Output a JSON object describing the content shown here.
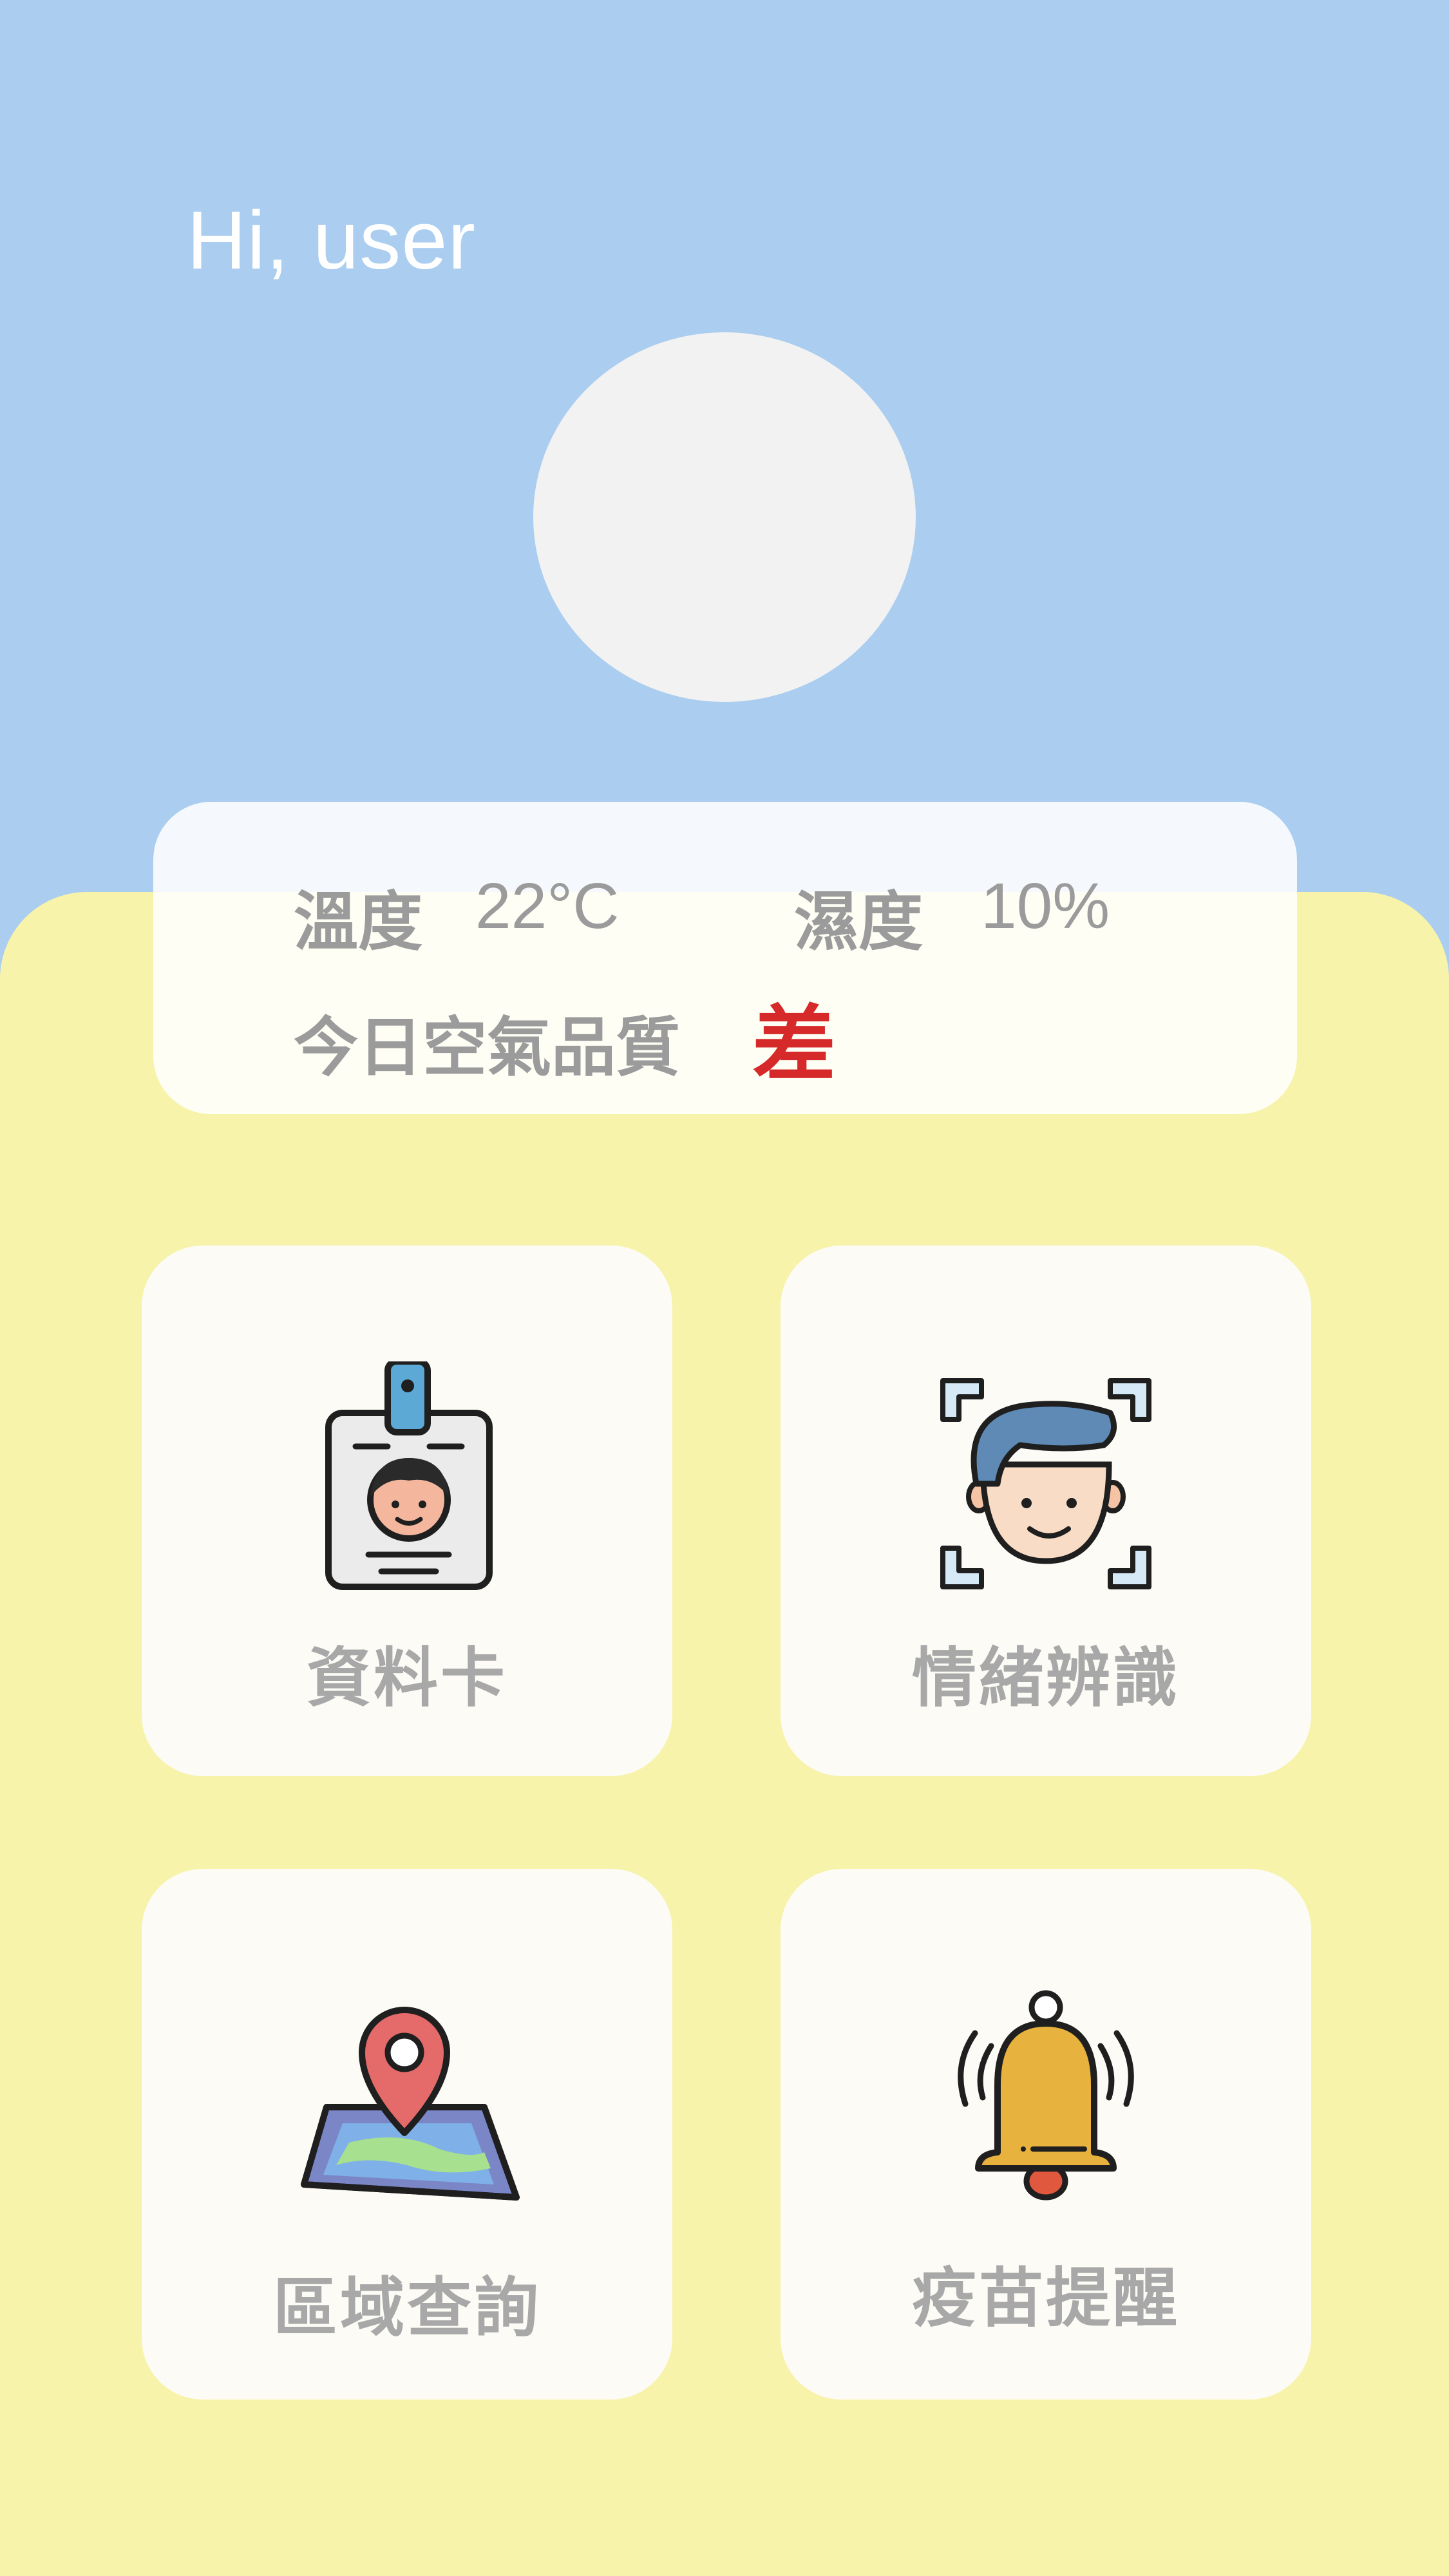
{
  "header": {
    "greeting": "Hi, user"
  },
  "weather": {
    "temp_label": "溫度",
    "temp_value": "22°C",
    "humidity_label": "濕度",
    "humidity_value": "10%",
    "air_quality_label": "今日空氣品質",
    "air_quality_value": "差",
    "air_quality_color": "#d62a2a"
  },
  "tiles": [
    {
      "label": "資料卡",
      "icon": "id-card-icon"
    },
    {
      "label": "情緒辨識",
      "icon": "face-scan-icon"
    },
    {
      "label": "區域查詢",
      "icon": "map-pin-icon"
    },
    {
      "label": "疫苗提醒",
      "icon": "bell-icon"
    }
  ],
  "colors": {
    "sky": "#aacdf0",
    "panel": "#f7f3aa",
    "card": "#fcfbf5"
  }
}
